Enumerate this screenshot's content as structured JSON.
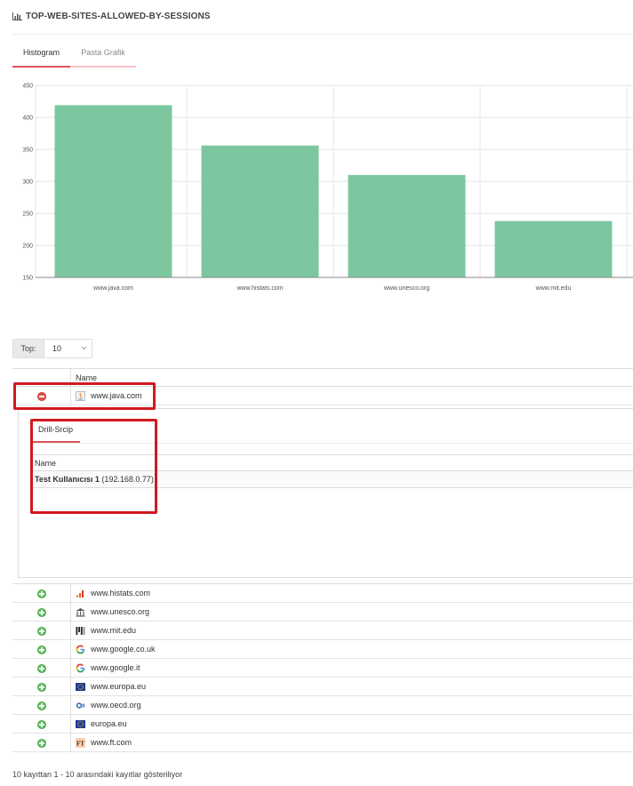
{
  "header": {
    "title": "TOP-WEB-SITES-ALLOWED-BY-SESSIONS",
    "icon": "bar-chart-icon"
  },
  "tabs": [
    {
      "label": "Histogram",
      "active": true
    },
    {
      "label": "Pasta Grafik",
      "active": false
    }
  ],
  "chart_data": {
    "type": "bar",
    "categories": [
      "www.java.com",
      "www.histats.com",
      "www.unesco.org",
      "www.mit.edu"
    ],
    "values": [
      419,
      356,
      310,
      238
    ],
    "ylim": [
      150,
      450
    ],
    "yticks": [
      "150",
      "200",
      "250",
      "300",
      "350",
      "400",
      "450"
    ],
    "grid": true,
    "bar_color": "#7cc79f"
  },
  "top_select": {
    "label": "Top:",
    "value": "10"
  },
  "table": {
    "column_name": "Name",
    "rows": [
      {
        "site": "www.java.com",
        "icon": "java-icon",
        "expanded": true
      },
      {
        "site": "www.histats.com",
        "icon": "histats-icon",
        "expanded": false
      },
      {
        "site": "www.unesco.org",
        "icon": "unesco-icon",
        "expanded": false
      },
      {
        "site": "www.mit.edu",
        "icon": "mit-icon",
        "expanded": false
      },
      {
        "site": "www.google.co.uk",
        "icon": "google-icon",
        "expanded": false
      },
      {
        "site": "www.google.it",
        "icon": "google-icon",
        "expanded": false
      },
      {
        "site": "www.europa.eu",
        "icon": "eu-flag-icon",
        "expanded": false
      },
      {
        "site": "www.oecd.org",
        "icon": "oecd-icon",
        "expanded": false
      },
      {
        "site": "europa.eu",
        "icon": "eu-flag-icon",
        "expanded": false
      },
      {
        "site": "www.ft.com",
        "icon": "ft-icon",
        "expanded": false
      }
    ]
  },
  "detail": {
    "tab_label": "Drill-Srcip",
    "column_name": "Name",
    "user_name": "Test Kullanıcısı 1",
    "user_ip": "(192.168.0.77)"
  },
  "footer": {
    "text": "10 kayıttan 1 - 10 arasındaki kayıtlar gösteriliyor"
  }
}
